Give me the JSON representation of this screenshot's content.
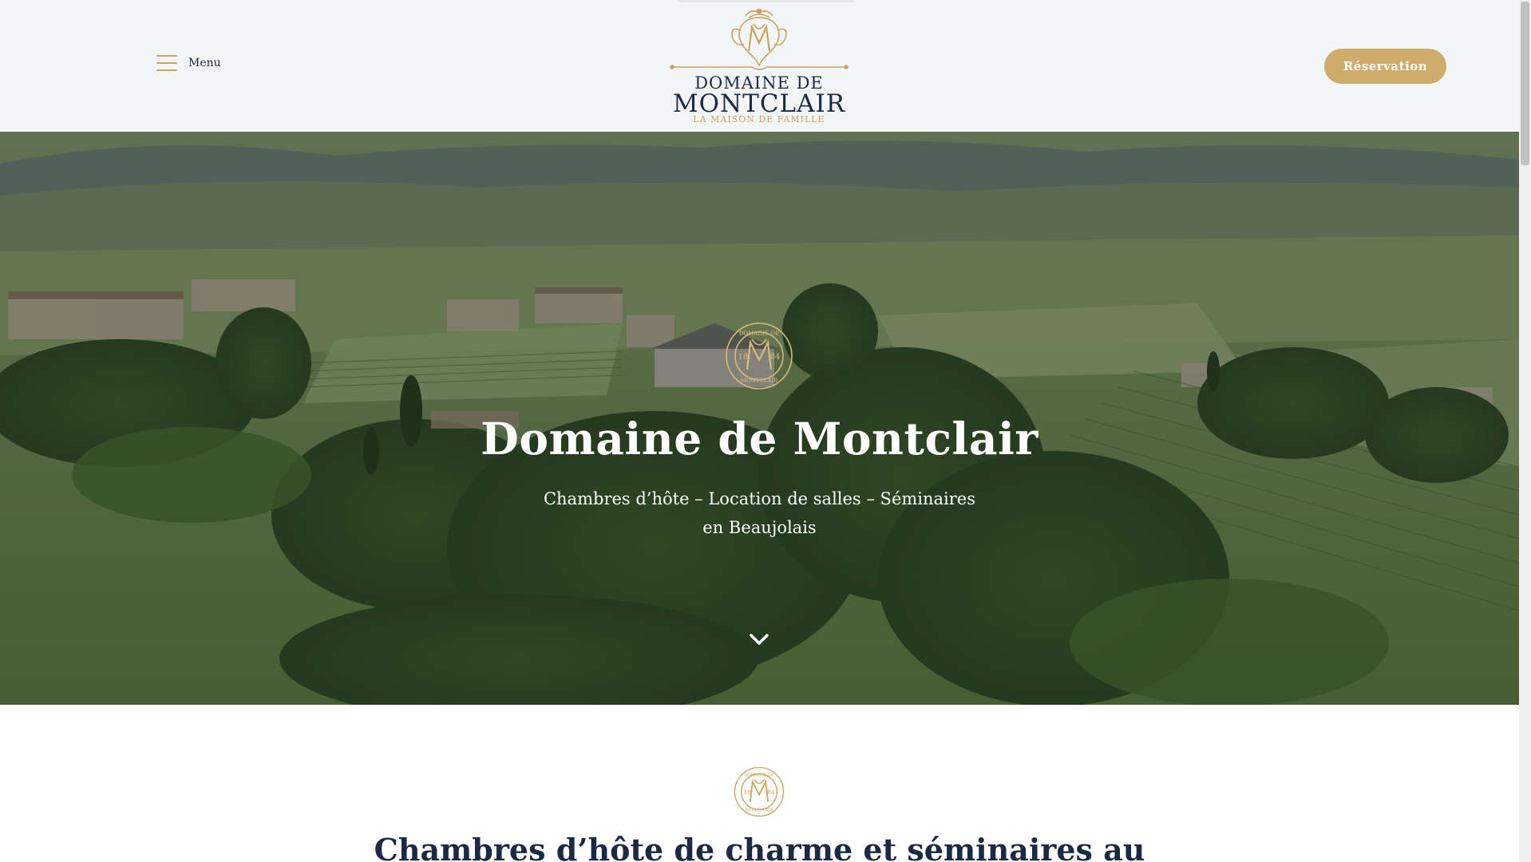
{
  "header": {
    "menu_label": "Menu",
    "logo": {
      "line1": "DOMAINE DE",
      "line2": "MONTCLAIR",
      "tagline": "LA MAISON DE FAMILLE"
    },
    "reservation_label": "Réservation"
  },
  "hero": {
    "emblem": {
      "top_text": "DOMAINE DE",
      "bottom_text": "MONTCLAIR",
      "year_left": "18",
      "year_right": "84"
    },
    "title": "Domaine de Montclair",
    "subtitle_line1": "Chambres d’hôte – Location de salles – Séminaires",
    "subtitle_line2": "en Beaujolais"
  },
  "content": {
    "section_title": "Chambres d’hôte de charme et séminaires au"
  },
  "colors": {
    "gold": "#c9a35f",
    "navy": "#1b2944",
    "header_bg": "#f3f6f9"
  },
  "icons": [
    "menu-icon",
    "chevron-down-icon",
    "monogram-emblem"
  ]
}
